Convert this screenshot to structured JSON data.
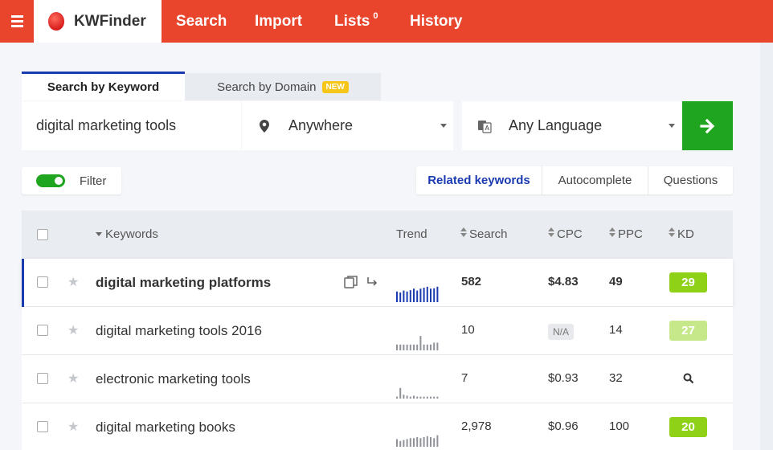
{
  "nav": {
    "brand": "KWFinder",
    "items": [
      {
        "label": "Search"
      },
      {
        "label": "Import"
      },
      {
        "label": "Lists",
        "badge": "0"
      },
      {
        "label": "History"
      }
    ]
  },
  "search": {
    "tab_keyword": "Search by Keyword",
    "tab_domain": "Search by Domain",
    "tab_domain_badge": "NEW",
    "keyword_value": "digital marketing tools",
    "location": "Anywhere",
    "language": "Any Language"
  },
  "filter": {
    "label": "Filter",
    "enabled": true
  },
  "result_tabs": [
    {
      "label": "Related keywords",
      "active": true
    },
    {
      "label": "Autocomplete",
      "active": false
    },
    {
      "label": "Questions",
      "active": false
    }
  ],
  "table": {
    "headers": {
      "keywords": "Keywords",
      "trend": "Trend",
      "search": "Search",
      "cpc": "CPC",
      "ppc": "PPC",
      "kd": "KD"
    },
    "rows": [
      {
        "keyword": "digital marketing platforms",
        "search": "582",
        "cpc": "$4.83",
        "ppc": "49",
        "kd": "29",
        "kd_color": "#8fd117",
        "selected": true,
        "trend": [
          0.55,
          0.5,
          0.6,
          0.55,
          0.62,
          0.7,
          0.6,
          0.7,
          0.75,
          0.8,
          0.7,
          0.72,
          0.8
        ]
      },
      {
        "keyword": "digital marketing tools 2016",
        "search": "10",
        "cpc": "N/A",
        "ppc": "14",
        "kd": "27",
        "kd_color": "#c7e88a",
        "selected": false,
        "trend": [
          0.3,
          0.3,
          0.3,
          0.3,
          0.3,
          0.3,
          0.3,
          0.75,
          0.3,
          0.3,
          0.3,
          0.4,
          0.4
        ]
      },
      {
        "keyword": "electronic marketing tools",
        "search": "7",
        "cpc": "$0.93",
        "ppc": "32",
        "kd": "",
        "kd_color": "",
        "selected": false,
        "trend": [
          0.1,
          0.55,
          0.2,
          0.15,
          0.1,
          0.15,
          0.1,
          0.1,
          0.1,
          0.1,
          0.1,
          0.1,
          0.1
        ]
      },
      {
        "keyword": "digital marketing books",
        "search": "2,978",
        "cpc": "$0.96",
        "ppc": "100",
        "kd": "20",
        "kd_color": "#8fd117",
        "selected": false,
        "trend": [
          0.4,
          0.3,
          0.35,
          0.4,
          0.45,
          0.45,
          0.5,
          0.45,
          0.5,
          0.55,
          0.5,
          0.45,
          0.6
        ]
      }
    ]
  },
  "colors": {
    "accent": "#e8452c",
    "primary": "#1a3bb0",
    "go": "#1fa51f",
    "trend_active": "#1a3bb0",
    "trend_idle": "#8f9399"
  }
}
